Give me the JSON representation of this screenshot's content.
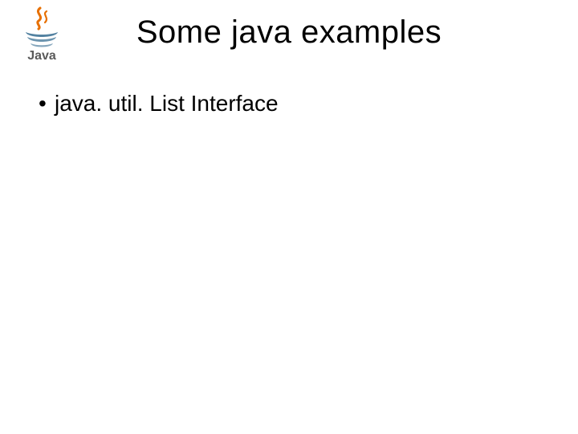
{
  "title": "Some java examples",
  "bullets": [
    "java. util. List Interface"
  ],
  "logo": {
    "word": "Java",
    "colors": {
      "cup_blue": "#5382a1",
      "steam_red": "#f8981d",
      "steam_red2": "#e76f00",
      "text": "#5a5a5a"
    }
  }
}
